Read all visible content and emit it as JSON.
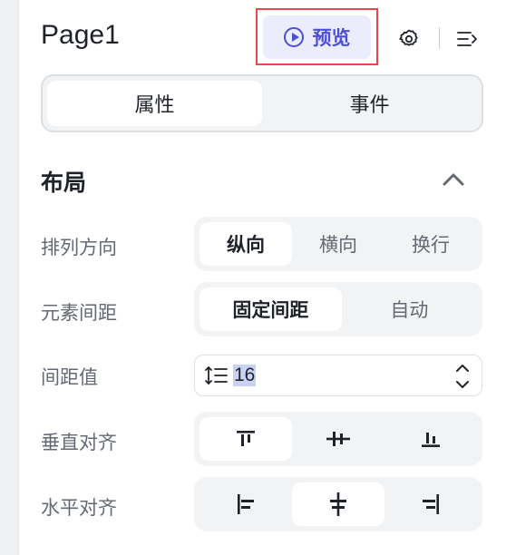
{
  "header": {
    "title": "Page1",
    "preview_label": "预览",
    "icons": [
      "play-circle-icon",
      "gear-icon",
      "collapse-panel-icon"
    ]
  },
  "tabs": [
    {
      "label": "属性",
      "active": true
    },
    {
      "label": "事件",
      "active": false
    }
  ],
  "layout_section": {
    "title": "布局",
    "expanded": true,
    "rows": {
      "direction": {
        "label": "排列方向",
        "options": [
          "纵向",
          "横向",
          "换行"
        ],
        "selected": "纵向"
      },
      "spacing_mode": {
        "label": "元素间距",
        "options": [
          "固定间距",
          "自动"
        ],
        "selected": "固定间距"
      },
      "spacing_value": {
        "label": "间距值",
        "value": "16"
      },
      "vertical_align": {
        "label": "垂直对齐",
        "options": [
          "align-top-icon",
          "align-middle-icon",
          "align-bottom-icon"
        ],
        "selected": "align-top-icon"
      },
      "horizontal_align": {
        "label": "水平对齐",
        "options": [
          "align-left-icon",
          "align-center-icon",
          "align-right-icon"
        ],
        "selected": "align-center-icon"
      }
    }
  },
  "colors": {
    "accent": "#4c4fd6",
    "accent_bg": "#ecedfc",
    "highlight_border": "#e5484d"
  }
}
